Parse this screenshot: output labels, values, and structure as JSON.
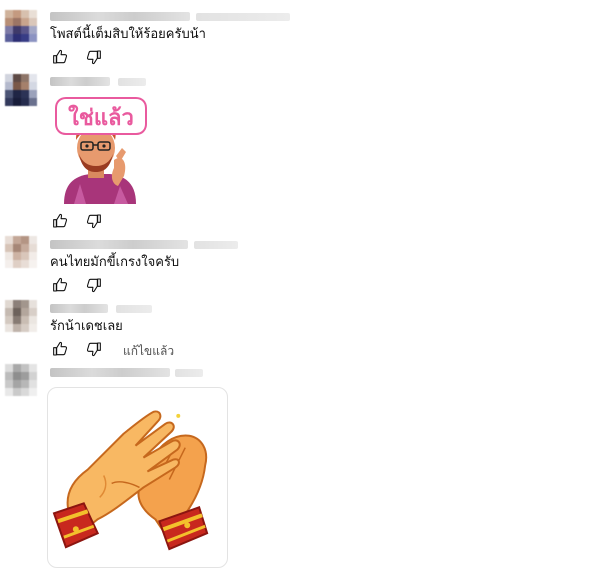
{
  "comments": [
    {
      "text": "โพสต์นี้เต็มสิบให้ร้อยครับน้า",
      "avatar_colors": [
        "#c9a58a",
        "#4b3f6e",
        "#8a8fb8",
        "#e6d6c8"
      ]
    },
    {
      "sticker_text": "ใช่แล้ว",
      "avatar_colors": [
        "#2b2f4a",
        "#6b4a3a",
        "#c0c6d9",
        "#1e2540"
      ]
    },
    {
      "text": "คนไทยมักขี้เกรงใจครับ",
      "avatar_colors": [
        "#d8c2b3",
        "#b89a88",
        "#efe6e0",
        "#a7897a"
      ]
    },
    {
      "text": "รักน้าเดชเลย",
      "edited_label": "แก้ไขแล้ว",
      "avatar_colors": [
        "#9a8f86",
        "#d3c9c0",
        "#6f655e",
        "#e4dcd6"
      ]
    },
    {
      "sticker": "clapping-hands",
      "avatar_colors": [
        "#bdbdbd",
        "#8e8e8e",
        "#d6d6d6",
        "#a3a3a3"
      ]
    }
  ],
  "icons": {
    "like": "thumbs-up-icon",
    "dislike": "thumbs-down-icon"
  },
  "colors": {
    "sticker_pink": "#e95a9e",
    "hand_orange": "#f4a24d",
    "cuff_red": "#c8281e",
    "cuff_gold": "#f3c02c"
  }
}
